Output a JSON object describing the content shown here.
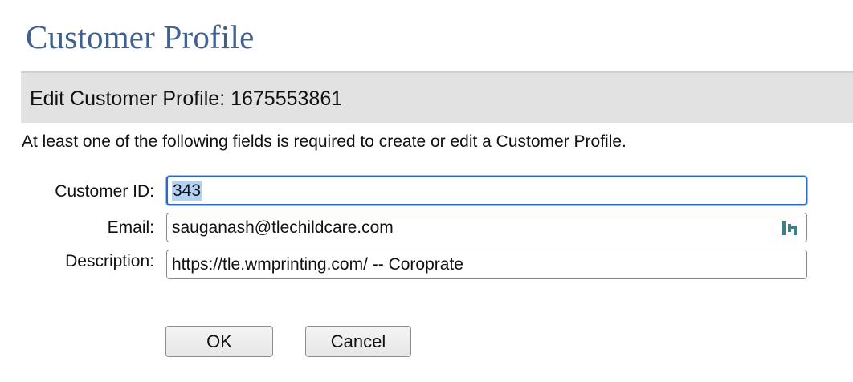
{
  "page": {
    "title": "Customer Profile"
  },
  "section": {
    "header": "Edit Customer Profile: 1675553861",
    "instructions": "At least one of the following fields is required to create or edit a Customer Profile."
  },
  "form": {
    "customer_id": {
      "label": "Customer ID:",
      "value": "343",
      "focused": true,
      "selected": true
    },
    "email": {
      "label": "Email:",
      "value": "sauganash@tlechildcare.com",
      "icon": "password-manager-icon"
    },
    "description": {
      "label": "Description:",
      "value": "https://tle.wmprinting.com/ -- Coroprate"
    }
  },
  "buttons": {
    "ok_label": "OK",
    "cancel_label": "Cancel"
  },
  "colors": {
    "title": "#3f6192",
    "section_header_bg": "#e2e2e2",
    "focus_ring": "#2f67c7",
    "selection": "#b3d1f3"
  }
}
